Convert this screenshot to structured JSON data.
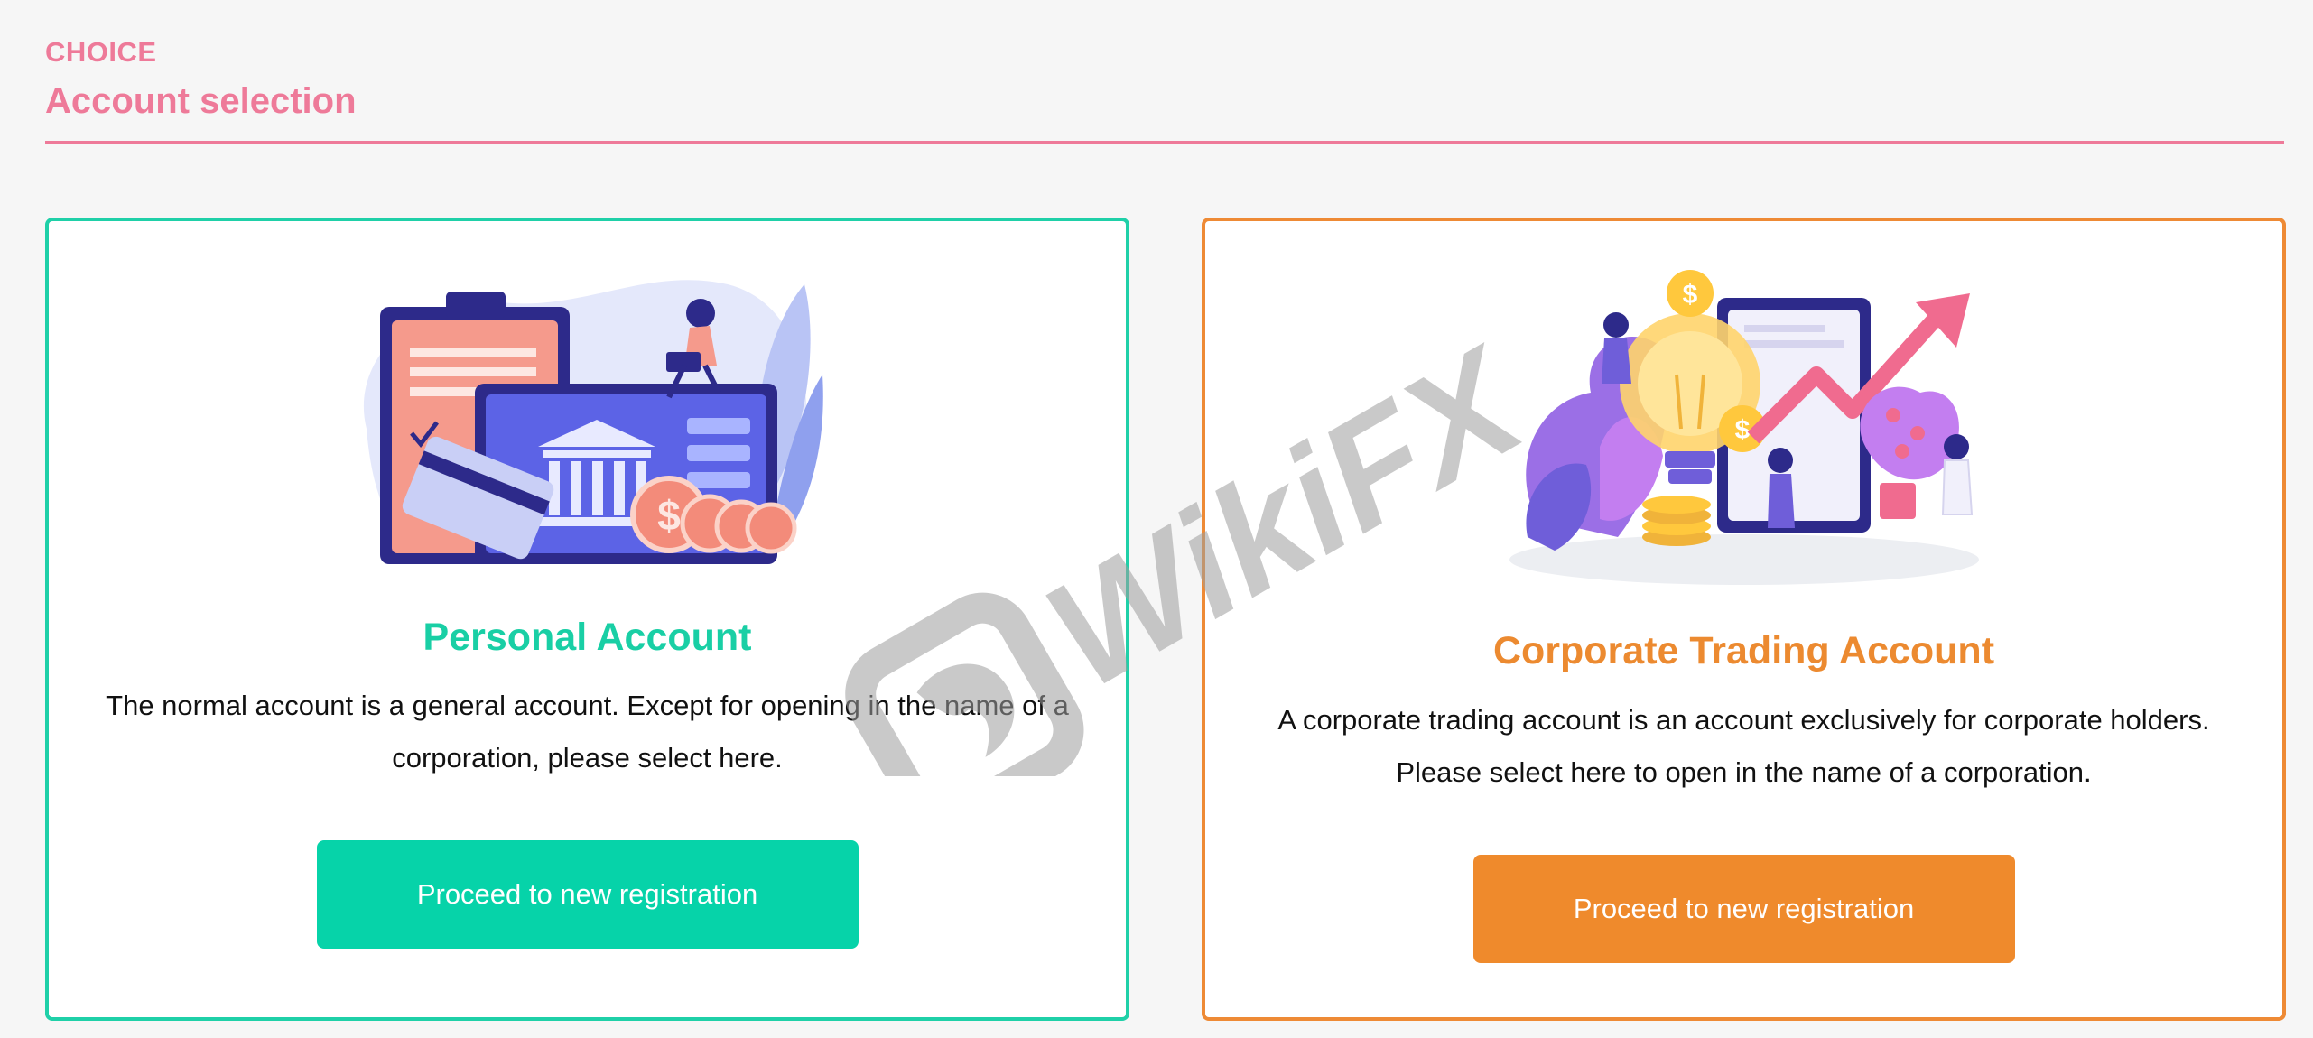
{
  "header": {
    "eyebrow": "CHOICE",
    "title": "Account selection"
  },
  "cards": [
    {
      "title": "Personal Account",
      "description": "The normal account is a general account. Except for opening in the name of a corporation, please select here.",
      "button_label": "Proceed to new registration",
      "accent_color": "#1fd0a8"
    },
    {
      "title": "Corporate Trading Account",
      "description": "A corporate trading account is an account exclusively for corporate holders. Please select here to open in the name of a corporation.",
      "button_label": "Proceed to new registration",
      "accent_color": "#ee8a35"
    }
  ],
  "watermark": {
    "text": "WikiFX"
  },
  "icons": [
    "bank-illustration",
    "finance-growth-illustration",
    "wikifx-watermark-logo"
  ]
}
